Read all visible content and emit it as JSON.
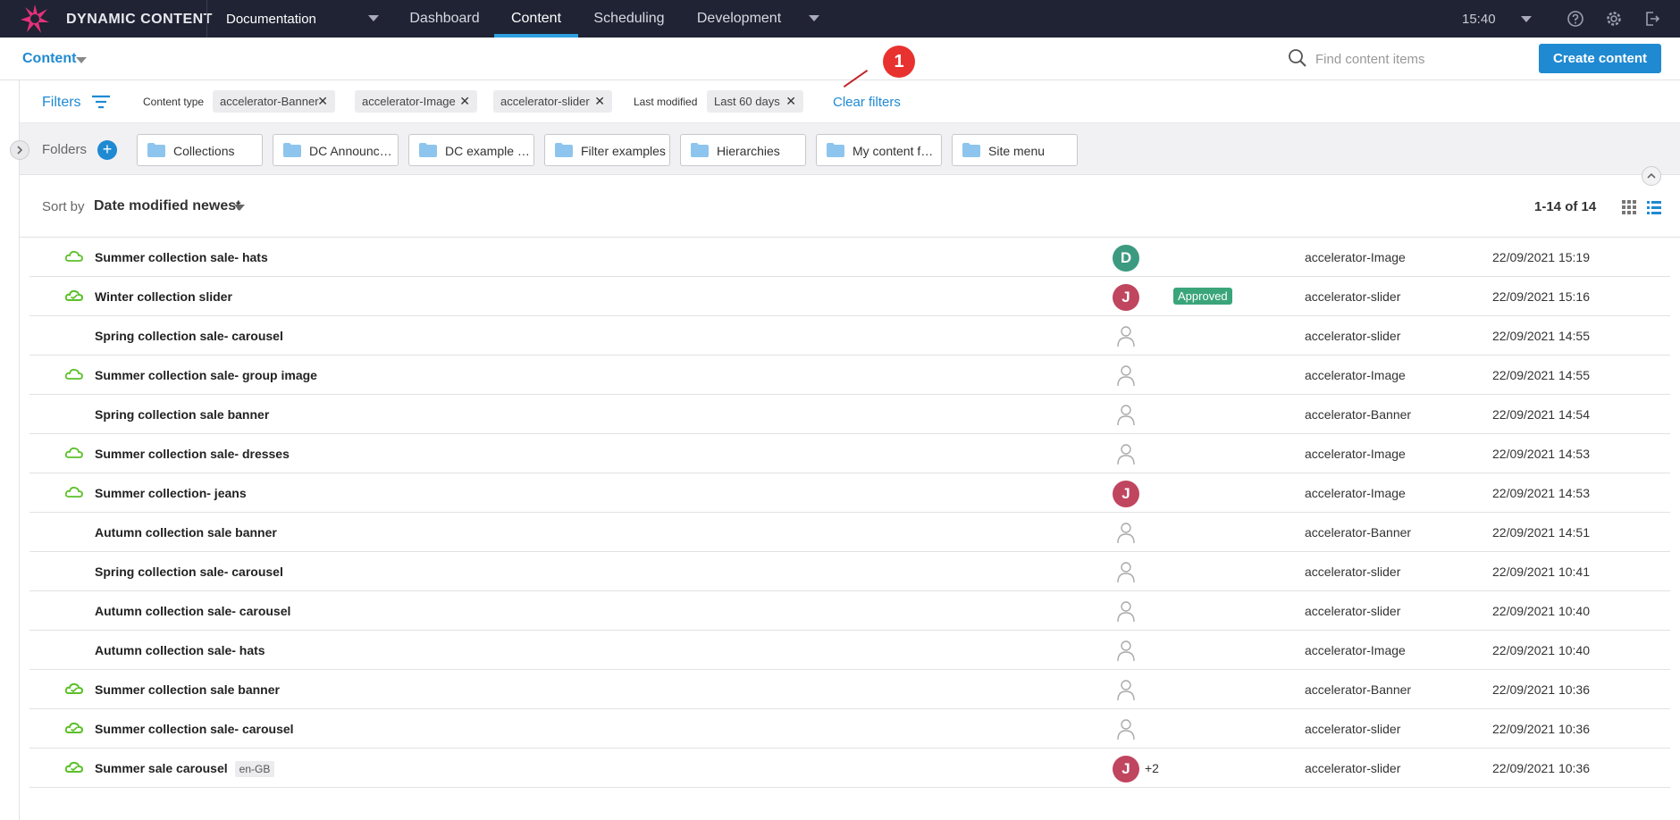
{
  "app": {
    "brand": "DYNAMIC CONTENT",
    "hub": "Documentation",
    "time": "15:40"
  },
  "nav": {
    "items": [
      "Dashboard",
      "Content",
      "Scheduling",
      "Development"
    ],
    "active": "Content"
  },
  "subheader": {
    "title": "Content",
    "search_placeholder": "Find content items",
    "create_label": "Create content"
  },
  "filters": {
    "label": "Filters",
    "content_type_label": "Content type",
    "content_types": [
      "accelerator-Banner",
      "accelerator-Image",
      "accelerator-slider"
    ],
    "last_modified_label": "Last modified",
    "last_modified": "Last 60 days",
    "clear_label": "Clear filters",
    "callout": "1"
  },
  "folders": {
    "label": "Folders",
    "add": "+",
    "items": [
      "Collections",
      "DC Announcements",
      "DC example content",
      "Filter examples",
      "Hierarchies",
      "My content folder",
      "Site menu"
    ]
  },
  "sort": {
    "label": "Sort by",
    "value": "Date modified newest",
    "count": "1-14 of 14"
  },
  "colors": {
    "accent": "#1f8ad2",
    "topbar": "#1f2333",
    "cloud": "#5cc02a",
    "avatar_d": "#3c9a80",
    "avatar_j": "#c0455f",
    "status_approved": "#3aa57a",
    "callout": "#e8322f"
  },
  "rows": [
    {
      "name": "Summer collection sale- hats",
      "cloud": "outline",
      "assignee": "D",
      "type": "accelerator-Image",
      "date": "22/09/2021 15:19"
    },
    {
      "name": "Winter collection slider",
      "cloud": "filled",
      "assignee": "J",
      "status": "Approved",
      "type": "accelerator-slider",
      "date": "22/09/2021 15:16"
    },
    {
      "name": "Spring collection sale- carousel",
      "cloud": "none",
      "assignee": "",
      "type": "accelerator-slider",
      "date": "22/09/2021 14:55"
    },
    {
      "name": "Summer collection sale- group image",
      "cloud": "outline",
      "assignee": "",
      "type": "accelerator-Image",
      "date": "22/09/2021 14:55"
    },
    {
      "name": "Spring collection sale banner",
      "cloud": "none",
      "assignee": "",
      "type": "accelerator-Banner",
      "date": "22/09/2021 14:54"
    },
    {
      "name": "Summer collection sale- dresses",
      "cloud": "outline",
      "assignee": "",
      "type": "accelerator-Image",
      "date": "22/09/2021 14:53"
    },
    {
      "name": "Summer collection- jeans",
      "cloud": "outline",
      "assignee": "J",
      "type": "accelerator-Image",
      "date": "22/09/2021 14:53"
    },
    {
      "name": "Autumn collection sale banner",
      "cloud": "none",
      "assignee": "",
      "type": "accelerator-Banner",
      "date": "22/09/2021 14:51"
    },
    {
      "name": "Spring collection sale- carousel",
      "cloud": "none",
      "assignee": "",
      "type": "accelerator-slider",
      "date": "22/09/2021 10:41"
    },
    {
      "name": "Autumn collection sale- carousel",
      "cloud": "none",
      "assignee": "",
      "type": "accelerator-slider",
      "date": "22/09/2021 10:40"
    },
    {
      "name": "Autumn collection sale- hats",
      "cloud": "none",
      "assignee": "",
      "type": "accelerator-Image",
      "date": "22/09/2021 10:40"
    },
    {
      "name": "Summer collection sale banner",
      "cloud": "filled",
      "assignee": "",
      "type": "accelerator-Banner",
      "date": "22/09/2021 10:36"
    },
    {
      "name": "Summer collection sale- carousel",
      "cloud": "filled",
      "assignee": "",
      "type": "accelerator-slider",
      "date": "22/09/2021 10:36"
    },
    {
      "name": "Summer sale carousel",
      "locale": "en-GB",
      "cloud": "filled",
      "assignee": "J",
      "extra": "+2",
      "type": "accelerator-slider",
      "date": "22/09/2021 10:36"
    }
  ]
}
